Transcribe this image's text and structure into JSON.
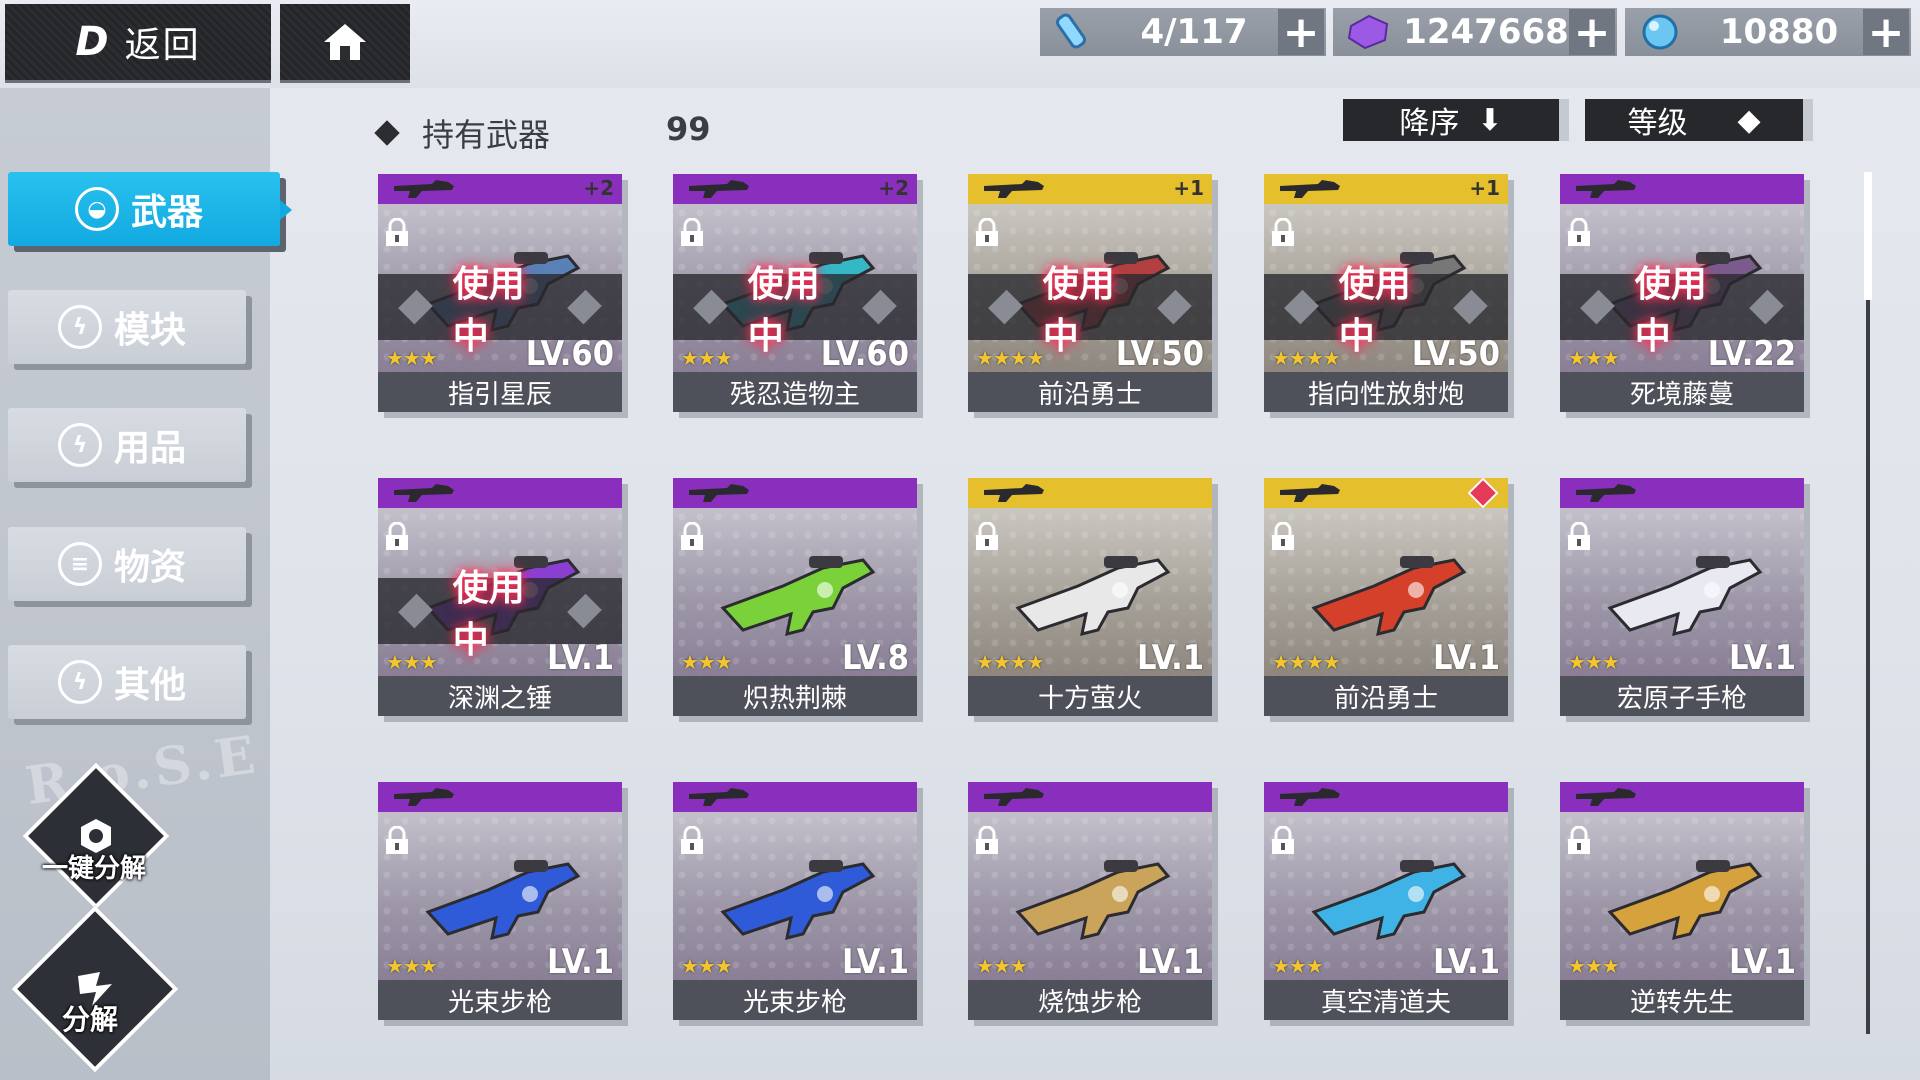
{
  "top": {
    "back_label": "返回",
    "back_logo": "D",
    "resources": [
      {
        "name": "energy",
        "value": "4/117",
        "icon": "energy-vial-icon"
      },
      {
        "name": "crystal",
        "value": "1247668",
        "icon": "purple-crystal-icon"
      },
      {
        "name": "orb",
        "value": "10880",
        "icon": "blue-orb-icon"
      }
    ],
    "plus": "+"
  },
  "sidebar": {
    "items": [
      {
        "label": "武器",
        "icon": "weapon-icon",
        "active": true
      },
      {
        "label": "模块",
        "icon": "lightning-icon"
      },
      {
        "label": "用品",
        "icon": "lightning-icon"
      },
      {
        "label": "物资",
        "icon": "supplies-icon"
      },
      {
        "label": "其他",
        "icon": "lightning-icon"
      }
    ],
    "watermark": "R.o.S.E",
    "one_click_dismantle": "一键分解",
    "dismantle": "分解"
  },
  "header": {
    "owned_label": "持有武器",
    "owned_count": "99",
    "sort_desc": "降序",
    "sort_level": "等级"
  },
  "in_use_label": "使用中",
  "colors": {
    "accent": "#12a9e1",
    "purple": "#8a2fbd",
    "gold": "#e6bf2c",
    "in_use_glow": "#ff2d55",
    "star": "#f3c630"
  },
  "weapons": [
    {
      "name": "指引星辰",
      "level": "LV.60",
      "stars": "★★★",
      "rarity": "purple",
      "in_use": true,
      "plus": "+2",
      "gun": "#5a80b8"
    },
    {
      "name": "残忍造物主",
      "level": "LV.60",
      "stars": "★★★",
      "rarity": "purple",
      "in_use": true,
      "plus": "+2",
      "gun": "#36b7c6"
    },
    {
      "name": "前沿勇士",
      "level": "LV.50",
      "stars": "★★★★",
      "rarity": "gold",
      "in_use": true,
      "plus": "+1",
      "gun": "#b24040"
    },
    {
      "name": "指向性放射炮",
      "level": "LV.50",
      "stars": "★★★★",
      "rarity": "gold",
      "in_use": true,
      "plus": "+1",
      "gun": "#777"
    },
    {
      "name": "死境藤蔓",
      "level": "LV.22",
      "stars": "★★★",
      "rarity": "purple",
      "in_use": true,
      "plus": "",
      "gun": "#7a5b8c"
    },
    {
      "name": "深渊之锤",
      "level": "LV.1",
      "stars": "★★★",
      "rarity": "purple",
      "in_use": true,
      "plus": "",
      "gun": "#8b3fd1"
    },
    {
      "name": "炽热荆棘",
      "level": "LV.8",
      "stars": "★★★",
      "rarity": "purple",
      "in_use": false,
      "plus": "",
      "gun": "#7ad13a"
    },
    {
      "name": "十方萤火",
      "level": "LV.1",
      "stars": "★★★★",
      "rarity": "gold",
      "in_use": false,
      "plus": "",
      "gun": "#e8e8e8"
    },
    {
      "name": "前沿勇士",
      "level": "LV.1",
      "stars": "★★★★",
      "rarity": "gold",
      "in_use": false,
      "plus": "",
      "gun": "#d4402a",
      "new": true
    },
    {
      "name": "宏原子手枪",
      "level": "LV.1",
      "stars": "★★★",
      "rarity": "purple",
      "in_use": false,
      "plus": "",
      "gun": "#e9e9f2"
    },
    {
      "name": "光束步枪",
      "level": "LV.1",
      "stars": "★★★",
      "rarity": "purple",
      "in_use": false,
      "plus": "",
      "gun": "#2f5bd8"
    },
    {
      "name": "光束步枪",
      "level": "LV.1",
      "stars": "★★★",
      "rarity": "purple",
      "in_use": false,
      "plus": "",
      "gun": "#2f5bd8"
    },
    {
      "name": "烧蚀步枪",
      "level": "LV.1",
      "stars": "★★★",
      "rarity": "purple",
      "in_use": false,
      "plus": "",
      "gun": "#c9a45a"
    },
    {
      "name": "真空清道夫",
      "level": "LV.1",
      "stars": "★★★",
      "rarity": "purple",
      "in_use": false,
      "plus": "",
      "gun": "#3fb3e6"
    },
    {
      "name": "逆转先生",
      "level": "LV.1",
      "stars": "★★★",
      "rarity": "purple",
      "in_use": false,
      "plus": "",
      "gun": "#d6a23e"
    }
  ]
}
